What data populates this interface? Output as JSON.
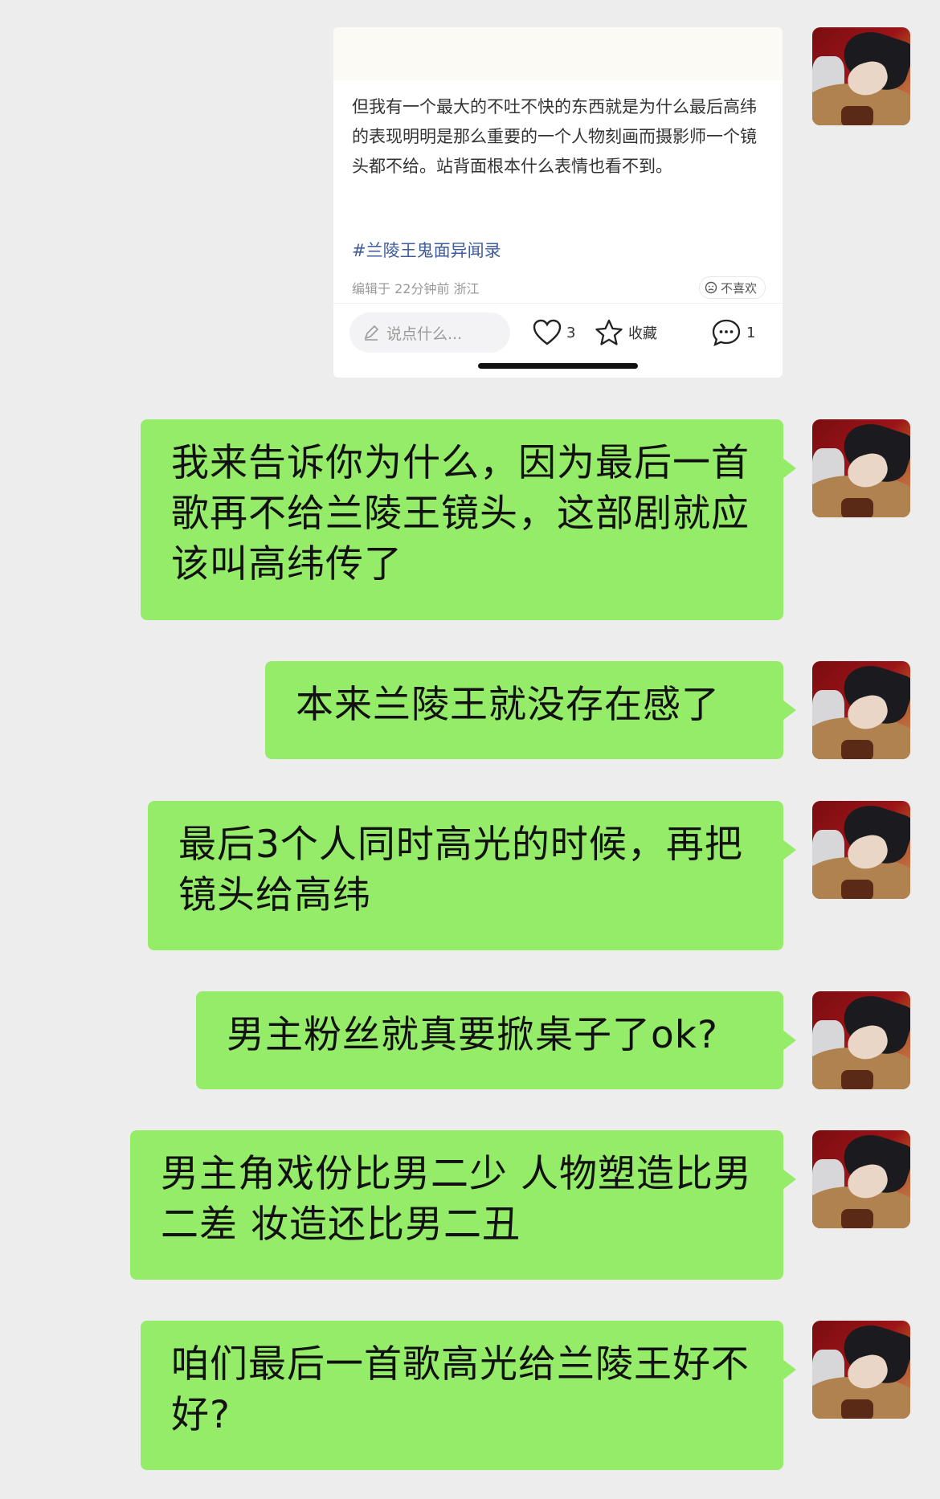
{
  "card": {
    "body": "但我有一个最大的不吐不快的东西就是为什么最后高纬的表现明明是那么重要的一个人物刻画而摄影师一个镜头都不给。站背面根本什么表情也看不到。",
    "tag": "#兰陵王鬼面异闻录",
    "meta": "编辑于 22分钟前 浙江",
    "dislike": "不喜欢",
    "comment_placeholder": "说点什么...",
    "like_count": "3",
    "collect_label": "收藏",
    "comment_count": "1"
  },
  "messages": [
    {
      "text": "我来告诉你为什么，因为最后一首歌再不给兰陵王镜头，这部剧就应该叫高纬传了"
    },
    {
      "text": "本来兰陵王就没存在感了"
    },
    {
      "text": "最后3个人同时高光的时候，再把镜头给高纬"
    },
    {
      "text": "男主粉丝就真要掀桌子了ok?"
    },
    {
      "text": "男主角戏份比男二少 人物塑造比男二差 妆造还比男二丑"
    },
    {
      "text": "咱们最后一首歌高光给兰陵王好不好?"
    }
  ],
  "colors": {
    "bubble": "#95ec69",
    "background": "#ededed",
    "tag": "#3e5c9a"
  }
}
